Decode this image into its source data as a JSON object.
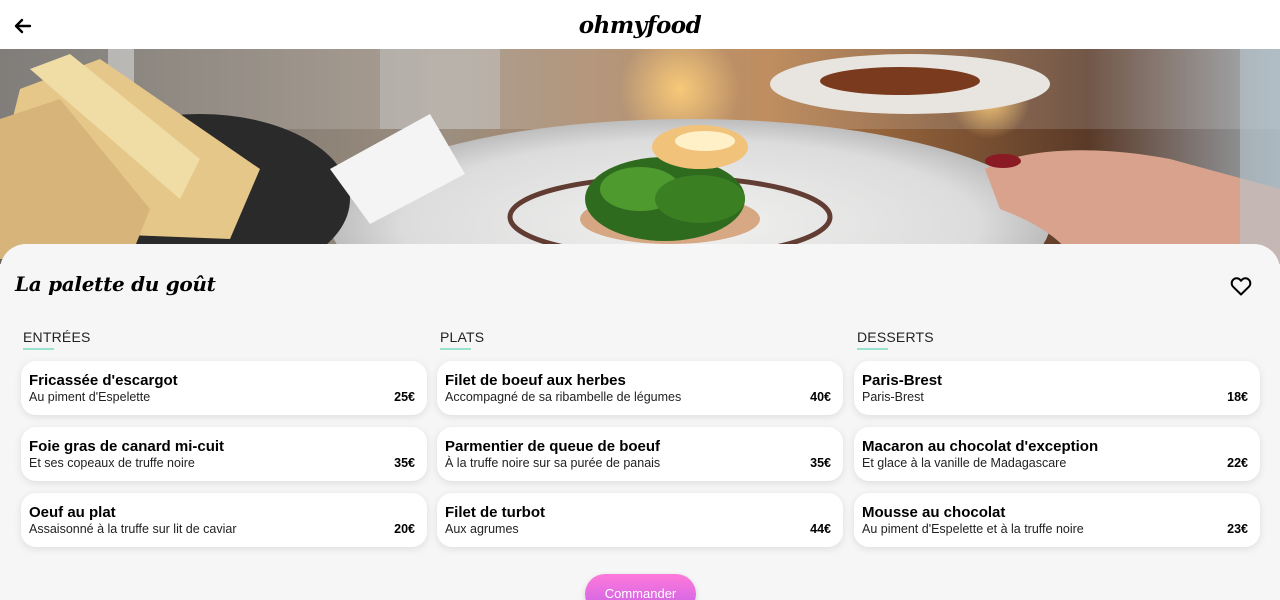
{
  "header": {
    "brand": "ohmyfood",
    "back_icon": "arrow-left-icon"
  },
  "restaurant": {
    "name": "La palette du goût",
    "like_icon": "heart-outline-icon"
  },
  "menu": {
    "columns": [
      {
        "heading": "ENTRÉES",
        "dishes": [
          {
            "name": "Fricassée d'escargot",
            "desc": "Au piment d'Espelette",
            "price": "25€"
          },
          {
            "name": "Foie gras de canard mi-cuit",
            "desc": "Et ses copeaux de truffe noire",
            "price": "35€"
          },
          {
            "name": "Oeuf au plat",
            "desc": "Assaisonné à la truffe sur lit de caviar",
            "price": "20€"
          }
        ]
      },
      {
        "heading": "PLATS",
        "dishes": [
          {
            "name": "Filet de boeuf aux herbes",
            "desc": "Accompagné de sa ribambelle de légumes",
            "price": "40€"
          },
          {
            "name": "Parmentier de queue de boeuf",
            "desc": "À la truffe noire sur sa purée de panais",
            "price": "35€"
          },
          {
            "name": "Filet de turbot",
            "desc": "Aux agrumes",
            "price": "44€"
          }
        ]
      },
      {
        "heading": "DESSERTS",
        "dishes": [
          {
            "name": "Paris-Brest",
            "desc": "Paris-Brest",
            "price": "18€"
          },
          {
            "name": "Macaron au chocolat d'exception",
            "desc": "Et glace à la vanille de Madagascare",
            "price": "22€"
          },
          {
            "name": "Mousse au chocolat",
            "desc": "Au piment d'Espelette et à la truffe noire",
            "price": "23€"
          }
        ]
      }
    ]
  },
  "order_button": {
    "label": "Commander"
  },
  "colors": {
    "accent_underline": "#99e2d0",
    "button_gradient_start": "#ff79da",
    "button_gradient_end": "#c561e8",
    "background": "#f6f6f6"
  }
}
